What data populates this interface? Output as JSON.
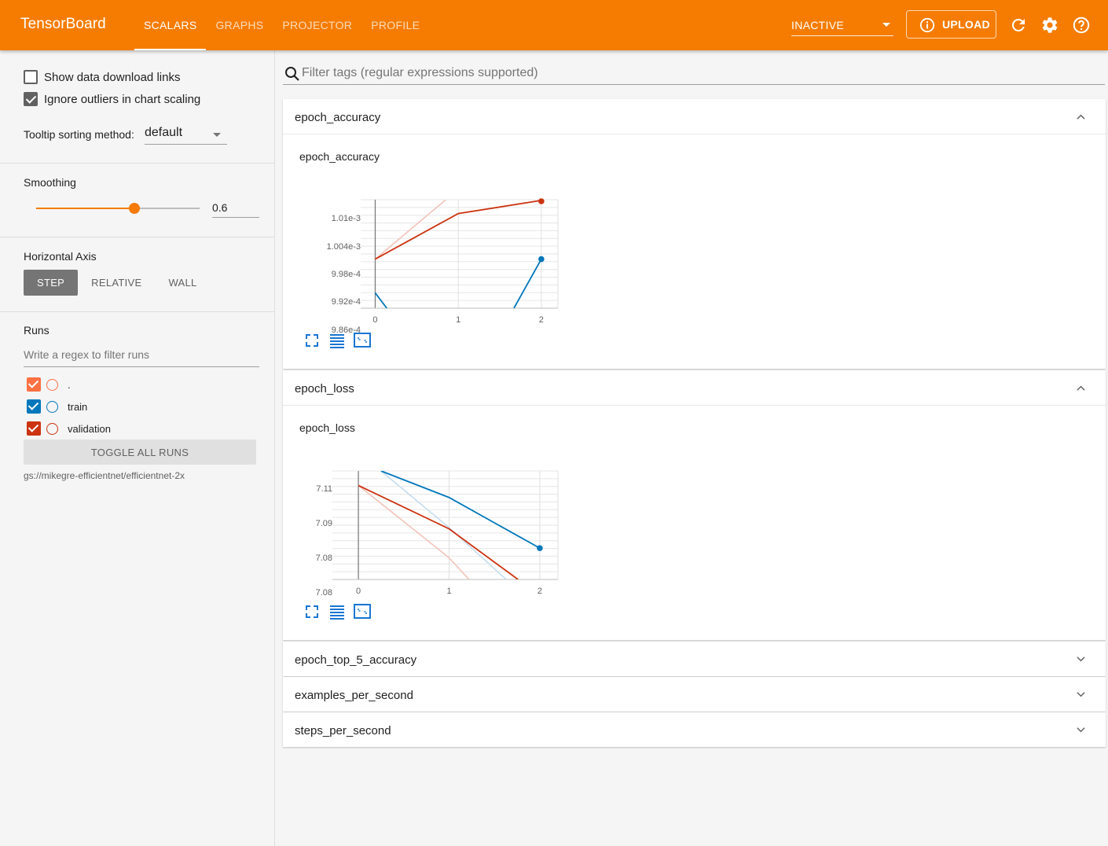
{
  "header": {
    "brand": "TensorBoard",
    "tabs": [
      "SCALARS",
      "GRAPHS",
      "PROJECTOR",
      "PROFILE"
    ],
    "active_tab": "SCALARS",
    "status_select": "INACTIVE",
    "upload_label": "UPLOAD",
    "icons": [
      "refresh-icon",
      "settings-icon",
      "help-icon"
    ],
    "accent_color": "#f57c00"
  },
  "sidebar": {
    "show_download_links": {
      "label": "Show data download links",
      "checked": false
    },
    "ignore_outliers": {
      "label": "Ignore outliers in chart scaling",
      "checked": true
    },
    "tooltip_sorting": {
      "label": "Tooltip sorting method:",
      "value": "default"
    },
    "smoothing": {
      "label": "Smoothing",
      "value": "0.6",
      "fraction": 0.6
    },
    "horizontal_axis": {
      "label": "Horizontal Axis",
      "options": [
        "STEP",
        "RELATIVE",
        "WALL"
      ],
      "selected": "STEP"
    },
    "runs": {
      "label": "Runs",
      "filter_placeholder": "Write a regex to filter runs",
      "items": [
        {
          "name": ".",
          "checked": true,
          "color": "#ff7043"
        },
        {
          "name": "train",
          "checked": true,
          "color": "#0077bb"
        },
        {
          "name": "validation",
          "checked": true,
          "color": "#cc3311"
        }
      ],
      "toggle_all_label": "TOGGLE ALL RUNS",
      "logdir": "gs://mikegre-efficientnet/efficientnet-2x"
    }
  },
  "main": {
    "filter_placeholder": "Filter tags (regular expressions supported)",
    "cards": [
      {
        "title": "epoch_accuracy",
        "expanded": true
      },
      {
        "title": "epoch_loss",
        "expanded": true
      },
      {
        "title": "epoch_top_5_accuracy",
        "expanded": false
      },
      {
        "title": "examples_per_second",
        "expanded": false
      },
      {
        "title": "steps_per_second",
        "expanded": false
      }
    ],
    "chart_tools": [
      "fullscreen-icon",
      "data-table-icon",
      "fit-domain-icon"
    ]
  },
  "chart_data": [
    {
      "type": "line",
      "title": "epoch_accuracy",
      "xlabel": "",
      "ylabel": "",
      "x_ticks": [
        "0",
        "1",
        "2"
      ],
      "y_ticks": [
        "1.01e-3",
        "1.004e-3",
        "9.98e-4",
        "9.92e-4",
        "9.86e-4"
      ],
      "xlim": [
        -0.08,
        2.2
      ],
      "ylim": [
        0.0009832,
        0.0010137
      ],
      "grid": true,
      "series": [
        {
          "name": "validation",
          "color": "#cc3311",
          "x": [
            0,
            1,
            2
          ],
          "y": [
            0.000997,
            0.0010098,
            0.0010135
          ]
        },
        {
          "name": "validation",
          "color": "#f2c2b8",
          "raw": true,
          "x": [
            0,
            0.85
          ],
          "y": [
            0.000997,
            0.0010137
          ]
        },
        {
          "name": "train",
          "color": "#0077bb",
          "x": [
            0,
            0.14
          ],
          "y": [
            0.0009875,
            0.0009832
          ]
        },
        {
          "name": "train",
          "color": "#0077bb",
          "x": [
            1.67,
            2
          ],
          "y": [
            0.0009832,
            0.000997
          ]
        }
      ]
    },
    {
      "type": "line",
      "title": "epoch_loss",
      "xlabel": "",
      "ylabel": "",
      "x_ticks": [
        "0",
        "1",
        "2"
      ],
      "y_ticks": [
        "7.11",
        "7.09",
        "7.08",
        "7.08"
      ],
      "xlim": [
        -0.2,
        2.2
      ],
      "ylim": [
        7.0705,
        7.1155
      ],
      "grid": true,
      "series": [
        {
          "name": "train",
          "color": "#0077bb",
          "x": [
            0.25,
            1,
            2
          ],
          "y": [
            7.1155,
            7.1045,
            7.0835
          ]
        },
        {
          "name": "train",
          "color": "#c5dcee",
          "raw": true,
          "x": [
            0.25,
            1,
            1.63
          ],
          "y": [
            7.1155,
            7.092,
            7.0705
          ]
        },
        {
          "name": "validation",
          "color": "#cc3311",
          "x": [
            0,
            1,
            1.76
          ],
          "y": [
            7.1095,
            7.0915,
            7.0705
          ]
        },
        {
          "name": "validation",
          "color": "#f2c2b8",
          "raw": true,
          "x": [
            0,
            1,
            1.22
          ],
          "y": [
            7.1095,
            7.0795,
            7.0705
          ]
        }
      ]
    }
  ]
}
